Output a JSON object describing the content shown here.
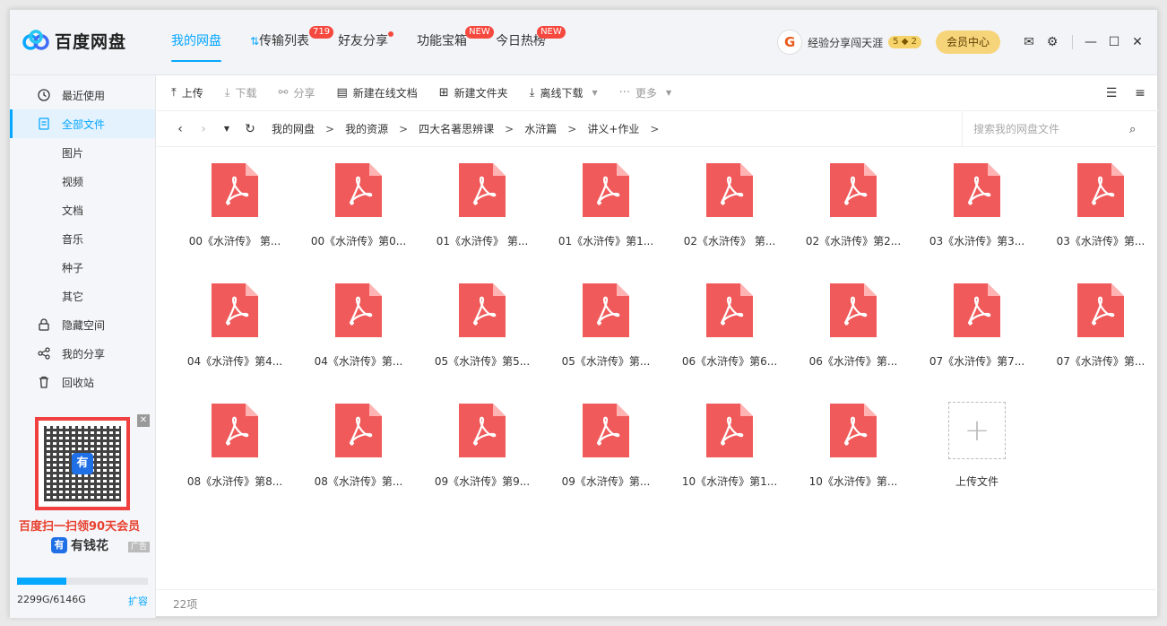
{
  "app": {
    "title": "百度网盘"
  },
  "nav": {
    "tabs": [
      {
        "label": "我的网盘",
        "badge": ""
      },
      {
        "label": "传输列表",
        "badge": "719"
      },
      {
        "label": "好友分享",
        "badge": ""
      },
      {
        "label": "功能宝箱",
        "badge": "NEW"
      },
      {
        "label": "今日热榜",
        "badge": "NEW"
      }
    ]
  },
  "user": {
    "name": "经验分享闯天涯",
    "level": "5",
    "level2": "2",
    "vip_label": "会员中心"
  },
  "sidebar": {
    "items": [
      {
        "label": "最近使用",
        "icon": "clock-icon"
      },
      {
        "label": "全部文件",
        "icon": "file-icon"
      },
      {
        "label": "图片"
      },
      {
        "label": "视频"
      },
      {
        "label": "文档"
      },
      {
        "label": "音乐"
      },
      {
        "label": "种子"
      },
      {
        "label": "其它"
      },
      {
        "label": "隐藏空间",
        "icon": "lock-icon"
      },
      {
        "label": "我的分享",
        "icon": "share-icon"
      },
      {
        "label": "回收站",
        "icon": "trash-icon"
      }
    ]
  },
  "ad": {
    "text": "百度扫一扫领90天会员",
    "brand": "有钱花",
    "tag": "广告",
    "qr_logo": "有"
  },
  "storage": {
    "used": "2299G/6146G",
    "fraction": 0.374,
    "expand": "扩容"
  },
  "toolbar": {
    "upload": "上传",
    "download": "下载",
    "share": "分享",
    "new_doc": "新建在线文档",
    "new_folder": "新建文件夹",
    "offline": "离线下载",
    "more": "更多"
  },
  "path": {
    "crumbs": [
      "我的网盘",
      "我的资源",
      "四大名著思辨课",
      "水浒篇",
      "讲义+作业"
    ]
  },
  "search": {
    "placeholder": "搜索我的网盘文件"
  },
  "files": [
    "00《水浒传》 第...",
    "00《水浒传》第0...",
    "01《水浒传》 第...",
    "01《水浒传》第1...",
    "02《水浒传》 第...",
    "02《水浒传》第2...",
    "03《水浒传》第3...",
    "03《水浒传》第...",
    "04《水浒传》第4...",
    "04《水浒传》第...",
    "05《水浒传》第5...",
    "05《水浒传》第...",
    "06《水浒传》第6...",
    "06《水浒传》第...",
    "07《水浒传》第7...",
    "07《水浒传》第...",
    "08《水浒传》第8...",
    "08《水浒传》第...",
    "09《水浒传》第9...",
    "09《水浒传》第...",
    "10《水浒传》第1...",
    "10《水浒传》第..."
  ],
  "upload_tile": {
    "label": "上传文件"
  },
  "status": {
    "count": "22项"
  },
  "colors": {
    "accent": "#06a7ff",
    "pdf": "#f05a5a"
  }
}
